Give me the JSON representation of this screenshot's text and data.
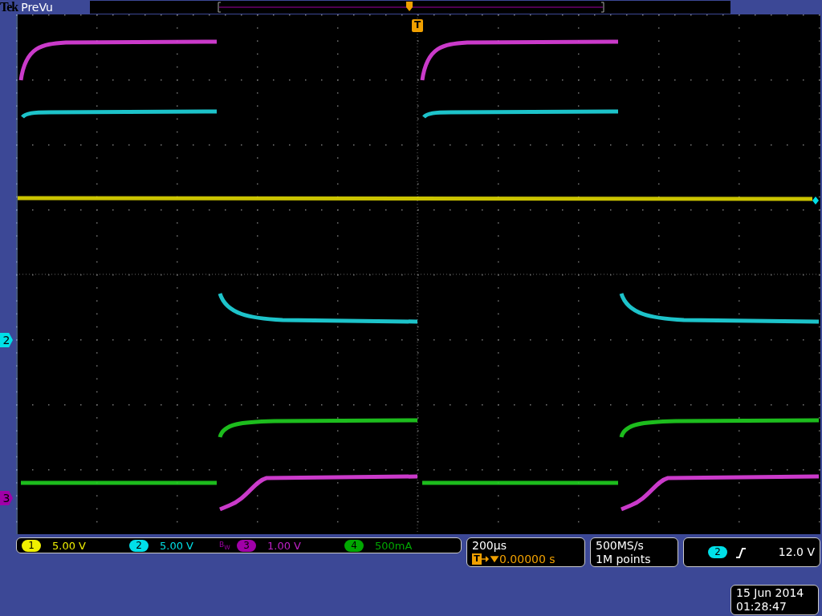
{
  "header": {
    "brand": "Tek",
    "mode": "PreVu"
  },
  "trigger_marker": "T",
  "side_markers": [
    {
      "label": "2",
      "color": "#00e0e8"
    },
    {
      "label": "3",
      "color": "#a000a8"
    }
  ],
  "channels": [
    {
      "badge": "1",
      "scale": "5.00 V",
      "color": "#f0f000"
    },
    {
      "badge": "2",
      "scale": "5.00 V",
      "color": "#00e0e8"
    },
    {
      "badge": "3",
      "scale": "1.00 V",
      "color": "#a000a8",
      "bw": "B$_{W}$"
    },
    {
      "badge": "4",
      "scale": "500mA",
      "color": "#00a800"
    }
  ],
  "timebase": {
    "scale": "200µs",
    "trigger_icon": "T",
    "position": "0.00000 s"
  },
  "acquisition": {
    "rate": "500MS/s",
    "length": "1M points"
  },
  "trigger": {
    "source": "2",
    "color": "#00e0e8",
    "level": "12.0 V"
  },
  "datetime": {
    "date": "15 Jun 2014",
    "time": "01:28:47"
  }
}
